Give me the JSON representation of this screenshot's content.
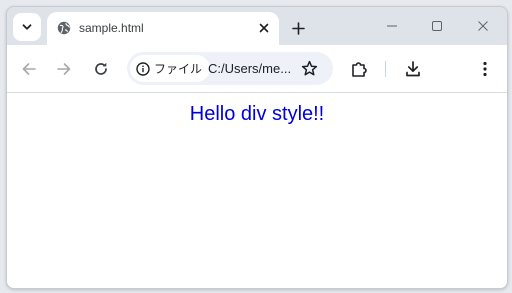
{
  "tab": {
    "title": "sample.html"
  },
  "toolbar": {
    "site_info_label": "ファイル",
    "url": "C:/Users/me..."
  },
  "page": {
    "text": "Hello div style!!",
    "text_color": "#0000dd"
  },
  "icons": {
    "tab_search": "chevron-down-icon",
    "favicon": "globe-icon",
    "tab_close": "close-icon",
    "new_tab": "plus-icon",
    "minimize": "minimize-icon",
    "maximize": "maximize-icon",
    "close_window": "close-icon",
    "back": "arrow-left-icon",
    "forward": "arrow-right-icon",
    "reload": "reload-icon",
    "info": "info-icon",
    "bookmark": "star-icon",
    "extensions": "puzzle-icon",
    "downloads": "download-icon",
    "menu": "more-vert-icon"
  },
  "colors": {
    "tabstrip": "#dee3ea",
    "omnibox": "#eef1f8",
    "hello_text": "#0000dd"
  }
}
